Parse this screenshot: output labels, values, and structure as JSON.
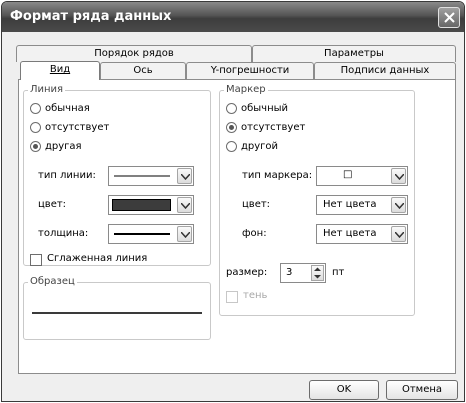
{
  "window": {
    "title": "Формат ряда данных"
  },
  "tabs_top": [
    "Порядок рядов",
    "Параметры"
  ],
  "tabs_bottom": [
    "Вид",
    "Ось",
    "Y-погрешности",
    "Подписи данных"
  ],
  "line_group": {
    "title": "Линия",
    "options": [
      "обычная",
      "отсутствует",
      "другая"
    ],
    "selected": "другая",
    "type_label": "тип линии:",
    "color_label": "цвет:",
    "color_value": "#3c3c3c",
    "weight_label": "толщина:",
    "smooth_label": "Сглаженная линия"
  },
  "marker_group": {
    "title": "Маркер",
    "options": [
      "обычный",
      "отсутствует",
      "другой"
    ],
    "selected": "отсутствует",
    "type_label": "тип маркера:",
    "type_value": "□",
    "color_label": "цвет:",
    "color_value": "Нет цвета",
    "fill_label": "фон:",
    "fill_value": "Нет цвета",
    "size_label": "размер:",
    "size_value": "3",
    "size_unit": "пт",
    "shadow_label": "тень"
  },
  "sample_group": {
    "title": "Образец"
  },
  "buttons": {
    "ok": "OK",
    "cancel": "Отмена"
  }
}
